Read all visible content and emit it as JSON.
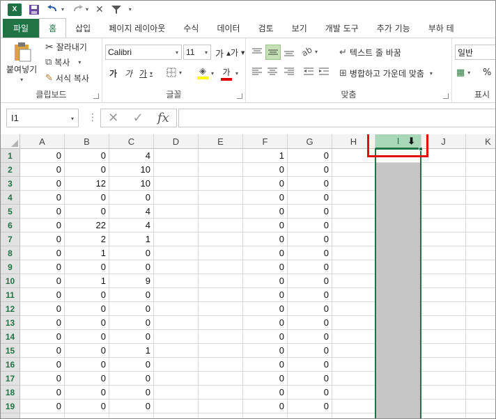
{
  "qat": {
    "app_icon": "excel-icon",
    "save_icon": "save-icon",
    "undo_icon": "undo-icon",
    "redo_icon": "redo-icon",
    "clear_icon": "close-icon",
    "filter_icon": "filter-icon",
    "customize_icon": "chevron-down-icon"
  },
  "tabs": [
    "파일",
    "홈",
    "삽입",
    "페이지 레이아웃",
    "수식",
    "데이터",
    "검토",
    "보기",
    "개발 도구",
    "추가 기능",
    "부하 테"
  ],
  "active_tab": "홈",
  "ribbon": {
    "clipboard": {
      "paste": "붙여넣기",
      "cut": "잘라내기",
      "copy": "복사",
      "format_painter": "서식 복사",
      "label": "클립보드"
    },
    "font": {
      "name": "Calibri",
      "size": "11",
      "bold": "가",
      "italic": "가",
      "underline": "가",
      "font_color": "가",
      "grow": "가",
      "shrink": "가",
      "label": "글꼴"
    },
    "alignment": {
      "wrap_text": "텍스트 줄 바꿈",
      "merge_center": "병합하고 가운데 맞춤",
      "label": "맞춤"
    },
    "number": {
      "format": "일반",
      "percent": "%",
      "label": "표시"
    }
  },
  "formula_bar": {
    "name_box": "I1",
    "cancel": "✕",
    "enter": "✓",
    "fx": "fx",
    "value": ""
  },
  "columns": [
    "A",
    "B",
    "C",
    "D",
    "E",
    "F",
    "G",
    "H",
    "I",
    "J",
    "K"
  ],
  "selected_column": "I",
  "rows": [
    {
      "n": "1",
      "A": "0",
      "B": "0",
      "C": "4",
      "F": "1",
      "G": "0"
    },
    {
      "n": "2",
      "A": "0",
      "B": "0",
      "C": "10",
      "F": "0",
      "G": "0"
    },
    {
      "n": "3",
      "A": "0",
      "B": "12",
      "C": "10",
      "F": "0",
      "G": "0"
    },
    {
      "n": "4",
      "A": "0",
      "B": "0",
      "C": "0",
      "F": "0",
      "G": "0"
    },
    {
      "n": "5",
      "A": "0",
      "B": "0",
      "C": "4",
      "F": "0",
      "G": "0"
    },
    {
      "n": "6",
      "A": "0",
      "B": "22",
      "C": "4",
      "F": "0",
      "G": "0"
    },
    {
      "n": "7",
      "A": "0",
      "B": "2",
      "C": "1",
      "F": "0",
      "G": "0"
    },
    {
      "n": "8",
      "A": "0",
      "B": "1",
      "C": "0",
      "F": "0",
      "G": "0"
    },
    {
      "n": "9",
      "A": "0",
      "B": "0",
      "C": "0",
      "F": "0",
      "G": "0"
    },
    {
      "n": "10",
      "A": "0",
      "B": "1",
      "C": "9",
      "F": "0",
      "G": "0"
    },
    {
      "n": "11",
      "A": "0",
      "B": "0",
      "C": "0",
      "F": "0",
      "G": "0"
    },
    {
      "n": "12",
      "A": "0",
      "B": "0",
      "C": "0",
      "F": "0",
      "G": "0"
    },
    {
      "n": "13",
      "A": "0",
      "B": "0",
      "C": "0",
      "F": "0",
      "G": "0"
    },
    {
      "n": "14",
      "A": "0",
      "B": "0",
      "C": "0",
      "F": "0",
      "G": "0"
    },
    {
      "n": "15",
      "A": "0",
      "B": "0",
      "C": "1",
      "F": "0",
      "G": "0"
    },
    {
      "n": "16",
      "A": "0",
      "B": "0",
      "C": "0",
      "F": "0",
      "G": "0"
    },
    {
      "n": "17",
      "A": "0",
      "B": "0",
      "C": "0",
      "F": "0",
      "G": "0"
    },
    {
      "n": "18",
      "A": "0",
      "B": "0",
      "C": "0",
      "F": "0",
      "G": "0"
    },
    {
      "n": "19",
      "A": "0",
      "B": "0",
      "C": "0",
      "F": "0",
      "G": "0"
    }
  ],
  "colors": {
    "brand_green": "#217346",
    "selection_gray": "#c6c6c6",
    "highlight_red": "#e01010"
  }
}
